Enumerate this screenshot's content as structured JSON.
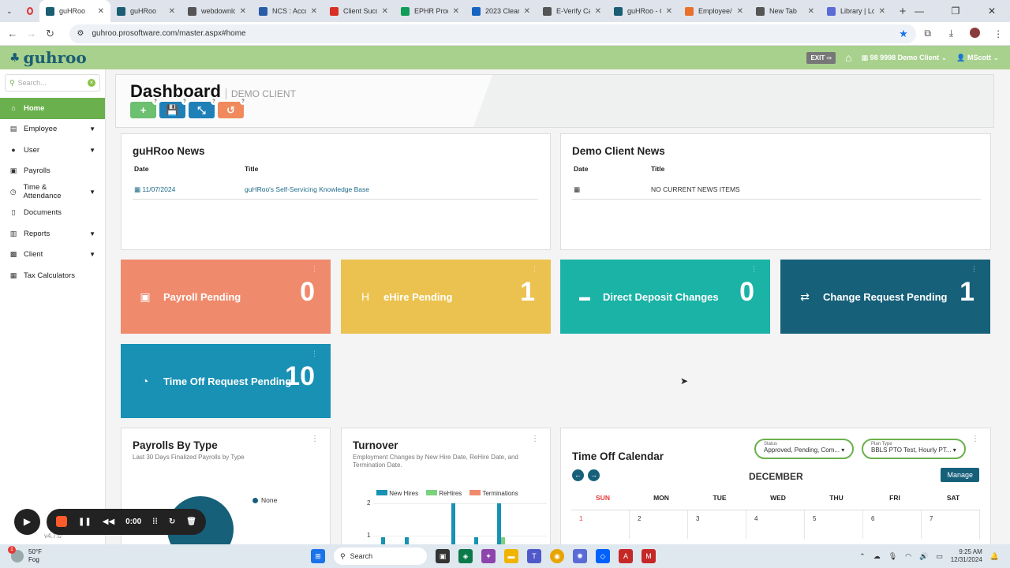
{
  "browser": {
    "tabs": [
      {
        "label": "guHRoo",
        "active": true,
        "color": "#1b5e73",
        "icon": "guhroo-icon"
      },
      {
        "label": "guHRoo",
        "color": "#1b5e73",
        "icon": "guhroo-icon"
      },
      {
        "label": "webdownlo",
        "color": "#555555",
        "icon": "globe-icon"
      },
      {
        "label": "NCS : Acco",
        "color": "#2a5da8",
        "icon": "ncs-icon"
      },
      {
        "label": "Client Succ",
        "color": "#d93025",
        "icon": "gmail-icon"
      },
      {
        "label": "EPHR Proce",
        "color": "#0f9d58",
        "icon": "sheets-icon"
      },
      {
        "label": "2023 Clean",
        "color": "#1565c0",
        "icon": "doc-icon"
      },
      {
        "label": "E-Verify Ca",
        "color": "#555555",
        "icon": "globe-icon"
      },
      {
        "label": "guHRoo - C",
        "color": "#1b5e73",
        "icon": "guhroo-icon"
      },
      {
        "label": "Employee/C",
        "color": "#e8712b",
        "icon": "pr-icon"
      },
      {
        "label": "New Tab",
        "color": "#555555",
        "icon": "globe-icon"
      },
      {
        "label": "Library | Lo",
        "color": "#5b6bd6",
        "icon": "library-icon"
      }
    ],
    "url": "guhroo.prosoftware.com/master.aspx#home"
  },
  "header": {
    "logo": "guhroo",
    "exit": "EXIT",
    "company": "98 9998 Demo Client",
    "user": "MScott"
  },
  "sidebar": {
    "search_placeholder": "Search...",
    "items": [
      {
        "label": "Home",
        "icon": "home-icon",
        "active": true,
        "caret": false
      },
      {
        "label": "Employee",
        "icon": "id-card-icon",
        "caret": true
      },
      {
        "label": "User",
        "icon": "user-icon",
        "caret": true
      },
      {
        "label": "Payrolls",
        "icon": "money-icon",
        "caret": false
      },
      {
        "label": "Time & Attendance",
        "icon": "clock-icon",
        "caret": true
      },
      {
        "label": "Documents",
        "icon": "document-icon",
        "caret": false
      },
      {
        "label": "Reports",
        "icon": "chart-icon",
        "caret": true
      },
      {
        "label": "Client",
        "icon": "briefcase-icon",
        "caret": true
      },
      {
        "label": "Tax Calculators",
        "icon": "calculator-icon",
        "caret": false
      }
    ],
    "version": "v4.7.0"
  },
  "dashboard": {
    "title": "Dashboard",
    "subtitle": "DEMO CLIENT",
    "buttons": [
      {
        "name": "add",
        "symbol": "+",
        "color": "#6cc070"
      },
      {
        "name": "save",
        "symbol": "💾",
        "color": "#1f80b8"
      },
      {
        "name": "compress",
        "symbol": "⤡",
        "color": "#1f80b8"
      },
      {
        "name": "reset",
        "symbol": "↺",
        "color": "#f08a5d"
      }
    ]
  },
  "guhroo_news": {
    "title": "guHRoo News",
    "col_date": "Date",
    "col_title": "Title",
    "date": "11/07/2024",
    "item": "guHRoo's Self-Servicing Knowledge Base"
  },
  "client_news": {
    "title": "Demo Client News",
    "col_date": "Date",
    "col_title": "Title",
    "item": "NO CURRENT NEWS ITEMS"
  },
  "stats": [
    {
      "label": "Payroll Pending",
      "value": "0",
      "color": "#f08a6c",
      "icon": "money-icon"
    },
    {
      "label": "eHire Pending",
      "value": "1",
      "color": "#ebc24f",
      "icon": "h-square-icon"
    },
    {
      "label": "Direct Deposit Changes",
      "value": "0",
      "color": "#1ab3a6",
      "icon": "credit-card-icon"
    },
    {
      "label": "Change Request Pending",
      "value": "1",
      "color": "#16607a",
      "icon": "exchange-icon"
    },
    {
      "label": "Time Off Request Pending",
      "value": "10",
      "color": "#1991b5",
      "icon": "stopwatch-icon"
    }
  ],
  "payrolls_by_type": {
    "title": "Payrolls By Type",
    "subtitle": "Last 30 Days Finalized Payrolls by Type",
    "legend": "None"
  },
  "turnover": {
    "title": "Turnover",
    "subtitle": "Employment Changes by New Hire Date, ReHire Date, and Termination Date.",
    "legend": [
      "New Hires",
      "ReHires",
      "Terminations"
    ],
    "ticks": [
      "2",
      "1"
    ]
  },
  "calendar": {
    "title": "Time Off Calendar",
    "status_label": "Status",
    "status_value": "Approved, Pending, Com...",
    "plan_label": "Plan Type",
    "plan_value": "BBLS PTO Test, Hourly PT...",
    "month": "DECEMBER",
    "manage": "Manage",
    "days": [
      "SUN",
      "MON",
      "TUE",
      "WED",
      "THU",
      "FRI",
      "SAT"
    ],
    "dates": [
      "1",
      "2",
      "3",
      "4",
      "5",
      "6",
      "7"
    ]
  },
  "recorder": {
    "time": "0:00"
  },
  "taskbar": {
    "weather_temp": "50°F",
    "weather_desc": "Fog",
    "search": "Search",
    "time": "9:25 AM",
    "date": "12/31/2024",
    "notification": "1"
  }
}
